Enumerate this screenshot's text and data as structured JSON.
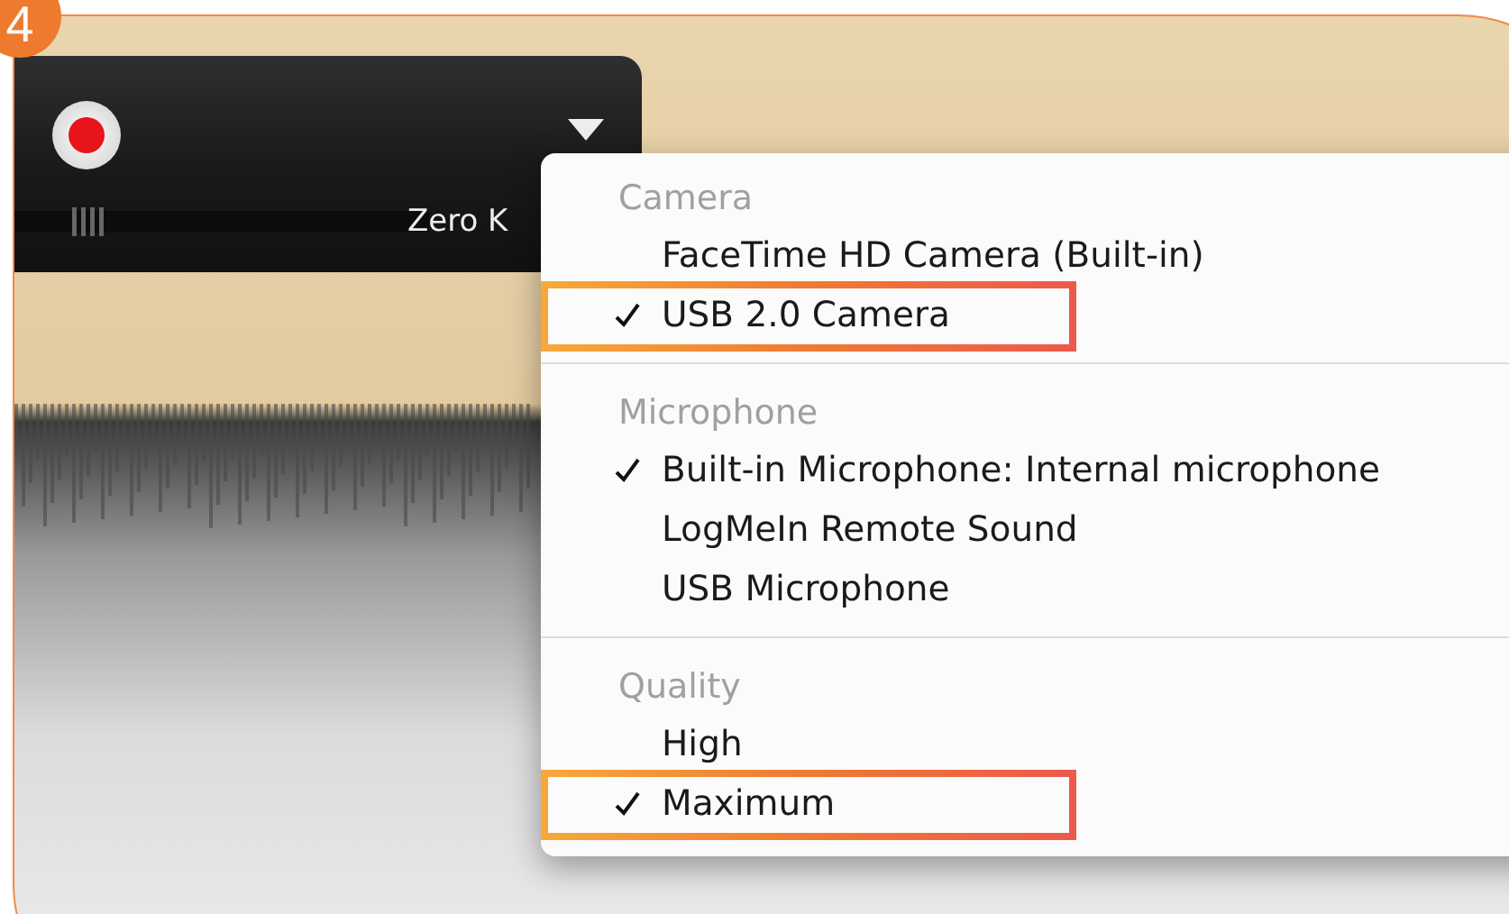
{
  "step_badge": "4",
  "recorder": {
    "status_text": "Zero K"
  },
  "menu": {
    "sections": [
      {
        "title": "Camera",
        "items": [
          {
            "label": "FaceTime HD Camera (Built-in)",
            "selected": false,
            "highlighted": false
          },
          {
            "label": "USB 2.0 Camera",
            "selected": true,
            "highlighted": true
          }
        ]
      },
      {
        "title": "Microphone",
        "items": [
          {
            "label": "Built-in Microphone: Internal microphone",
            "selected": true,
            "highlighted": false
          },
          {
            "label": "LogMeIn Remote Sound",
            "selected": false,
            "highlighted": false
          },
          {
            "label": "USB Microphone",
            "selected": false,
            "highlighted": false
          }
        ]
      },
      {
        "title": "Quality",
        "items": [
          {
            "label": "High",
            "selected": false,
            "highlighted": false
          },
          {
            "label": "Maximum",
            "selected": true,
            "highlighted": true
          }
        ]
      }
    ]
  }
}
